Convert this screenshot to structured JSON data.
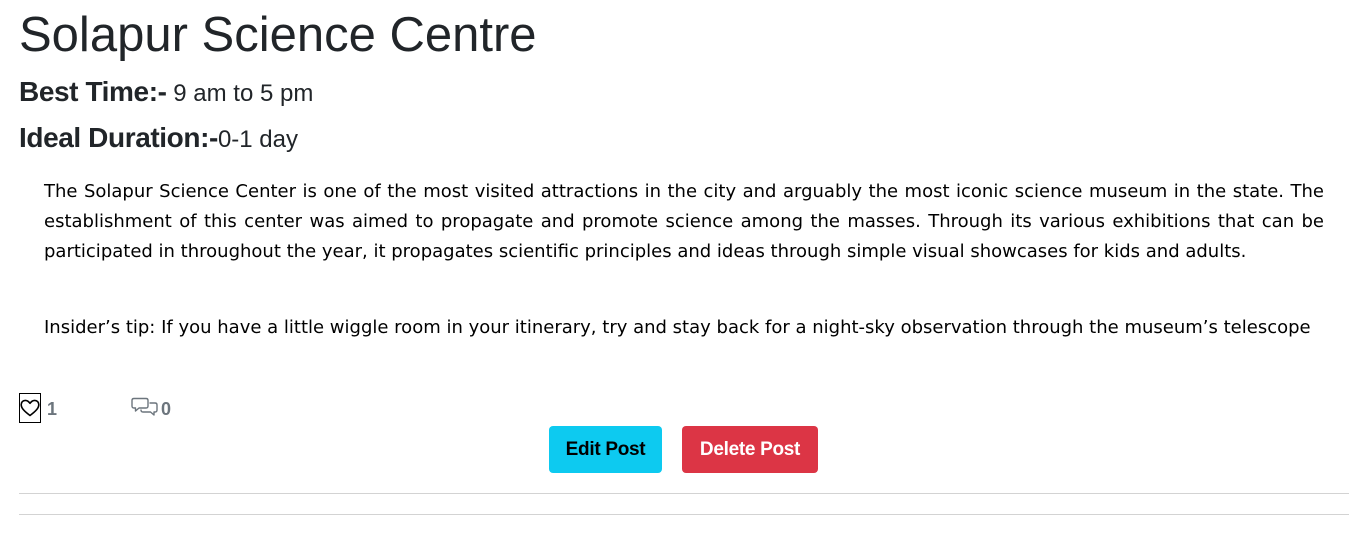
{
  "post": {
    "title": "Solapur Science Centre",
    "best_time_label": "Best Time:-",
    "best_time_value": " 9 am to 5 pm",
    "ideal_duration_label": "Ideal Duration:-",
    "ideal_duration_value": "0-1 day",
    "paragraphs": [
      "The Solapur Science Center is one of the most visited attractions in the city and arguably the most iconic science museum in the state. The establishment of this center was aimed to propagate and promote science among the masses. Through its various exhibitions that can be participated in throughout the year, it propagates scientific principles and ideas through simple visual showcases for kids and adults.",
      "Insider’s tip: If you have a little wiggle room in your itinerary, try and stay back for a night-sky observation through the museum’s telescope"
    ]
  },
  "reactions": {
    "like_icon": "heart-outline-icon",
    "like_count": "1",
    "comment_icon": "chat-bubbles-icon",
    "comment_count": "0"
  },
  "actions": {
    "edit_label": "Edit Post",
    "delete_label": "Delete Post"
  },
  "colors": {
    "edit_button": "#0dcaf0",
    "delete_button": "#dc3545",
    "count_text": "#6c757d",
    "divider": "#d3d3d3"
  }
}
